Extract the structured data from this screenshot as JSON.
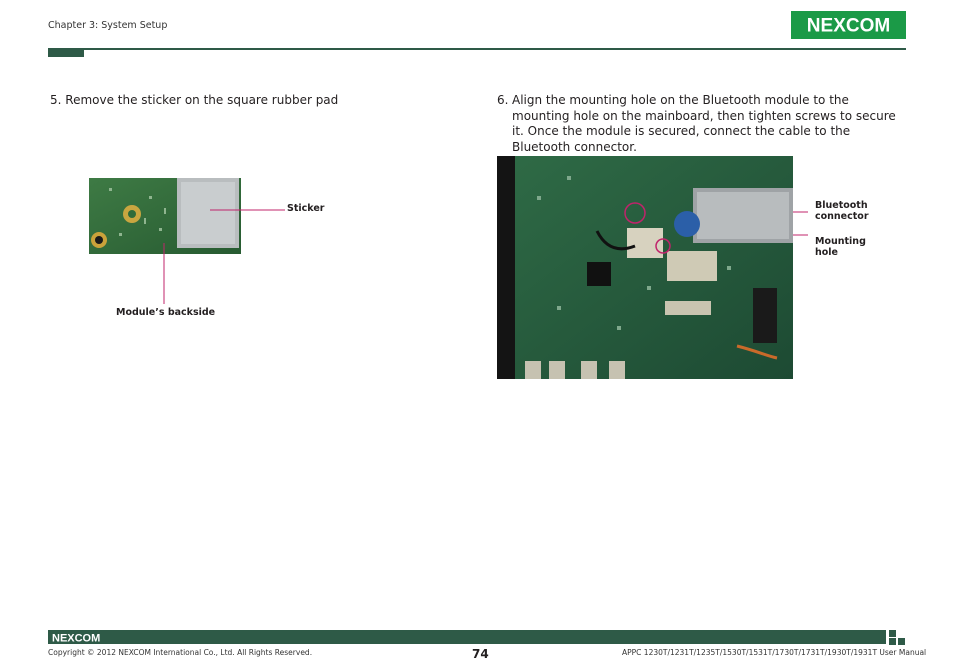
{
  "header": {
    "chapter": "Chapter 3: System Setup",
    "logo_text": "NEXCOM"
  },
  "steps": {
    "step5": {
      "text": "5.  Remove the sticker on the square rubber pad"
    },
    "step6": {
      "number": "6.",
      "text": "Align the mounting hole on the Bluetooth module to the mounting hole on the mainboard, then tighten screws to secure it. Once the module is secured, connect the cable to the Bluetooth connector."
    }
  },
  "figure_left": {
    "callout_sticker": "Sticker",
    "callout_backside": "Module’s backside"
  },
  "figure_right": {
    "callout_connector_line1": "Bluetooth",
    "callout_connector_line2": "connector",
    "callout_mounting_line1": "Mounting",
    "callout_mounting_line2": "hole"
  },
  "footer": {
    "logo_text": "NEXCOM",
    "copyright": "Copyright © 2012 NEXCOM International Co., Ltd. All Rights Reserved.",
    "page_number": "74",
    "manual_title": "APPC 1230T/1231T/1235T/1530T/1531T/1730T/1731T/1930T/1931T User Manual"
  },
  "colors": {
    "brand_green": "#2e5a47",
    "logo_green": "#1b9a47",
    "callout_magenta": "#c0246b"
  }
}
